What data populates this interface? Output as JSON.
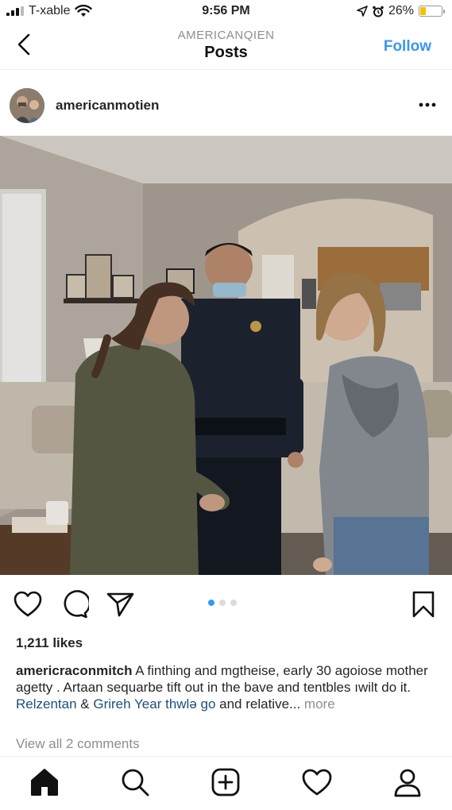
{
  "status_bar": {
    "carrier": "T-хable",
    "time": "9:56 PM",
    "battery": "26%",
    "battery_level": 0.26
  },
  "header": {
    "subtitle": "AMERICANQIEN",
    "title": "Posts",
    "follow_label": "Follow"
  },
  "post": {
    "username": "americanmotien",
    "likes": "1,211 likes",
    "caption_user": "americraconmitch",
    "caption_text_1": " A finthing and mgtheise, early 30 aɡoiose mother agetty . Artaan sequarbe tift out in the bave and tentbles ıwilt do it. ",
    "caption_tag_1": "Relzentan",
    "caption_amp": " & ",
    "caption_tag_2": "Grireh Year",
    "caption_space": " ",
    "caption_tag_3": "thwlə go",
    "caption_text_2": " and relative...",
    "caption_more": " more",
    "view_comments": "View all 2 comments",
    "carousel_count": 3,
    "carousel_active": 1
  },
  "colors": {
    "accent": "#3897f0",
    "text": "#262626",
    "muted": "#8e8e8e",
    "battery": "#f2c200"
  },
  "icons": {
    "back": "chevron-left-icon",
    "more": "more-horizontal-icon",
    "like": "heart-icon",
    "comment": "comment-icon",
    "share": "send-icon",
    "save": "bookmark-icon",
    "home": "home-icon",
    "search": "search-icon",
    "create": "plus-square-icon",
    "activity": "heart-icon",
    "profile": "profile-icon"
  }
}
